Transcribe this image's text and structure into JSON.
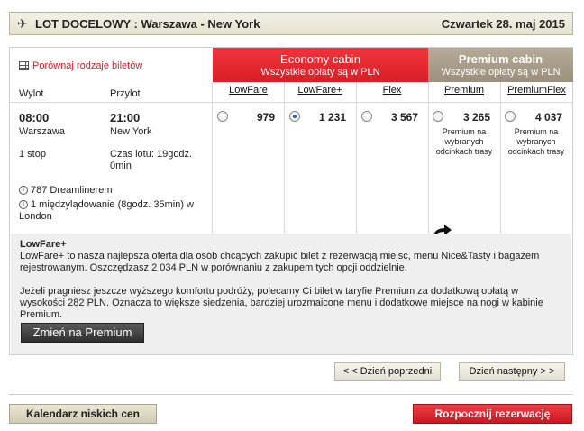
{
  "header": {
    "route_label": "LOT DOCELOWY :  Warszawa - New York",
    "date": "Czwartek 28. maj 2015"
  },
  "compare_link": "Porównaj rodzaje biletów",
  "cabins": {
    "economy": {
      "title": "Economy cabin",
      "subtitle": "Wszystkie opłaty są w PLN"
    },
    "premium": {
      "title": "Premium cabin",
      "subtitle": "Wszystkie opłaty są w PLN"
    }
  },
  "columns": {
    "departure": "Wylot",
    "arrival": "Przylot"
  },
  "fares": [
    {
      "name": "LowFare",
      "price": "979",
      "selected": false,
      "note": ""
    },
    {
      "name": "LowFare+",
      "price": "1 231",
      "selected": true,
      "note": ""
    },
    {
      "name": "Flex",
      "price": "3 567",
      "selected": false,
      "note": ""
    },
    {
      "name": "Premium",
      "price": "3 265",
      "selected": false,
      "note": "Premium na wybranych odcinkach trasy"
    },
    {
      "name": "PremiumFlex",
      "price": "4 037",
      "selected": false,
      "note": "Premium na wybranych odcinkach trasy"
    }
  ],
  "flight": {
    "dep_time": "08:00",
    "dep_city": "Warszawa",
    "arr_time": "21:00",
    "arr_city": "New York",
    "stops": "1 stop",
    "duration": "Czas lotu: 19godz. 0min",
    "aircraft": "787 Dreamlinerem",
    "layover": "1 międzylądowanie (8godz. 35min) w London"
  },
  "description": {
    "title": "LowFare+",
    "para1": "LowFare+ to nasza najlepsza oferta dla osób chcących zakupić bilet z rezerwacją miejsc, menu Nice&Tasty i bagażem rejestrowanym. Oszczędzasz 2 034 PLN w porównaniu z zakupem tych opcji oddzielnie.",
    "para2": "Jeżeli pragniesz jeszcze wyższego komfortu podróży, polecamy Ci bilet w taryfie Premium za dodatkową opłatą w wysokości 282 PLN. Oznacza to większe siedzenia, bardziej urozmaicone menu i dodatkowe miejsce na nogi w kabinie Premium.",
    "upgrade_button": "Zmień na Premium"
  },
  "nav": {
    "prev": "< < Dzień poprzedni",
    "next": "Dzień następny > >"
  },
  "footer": {
    "calendar_button": "Kalendarz niskich cen",
    "book_button": "Rozpocznij rezerwację"
  }
}
